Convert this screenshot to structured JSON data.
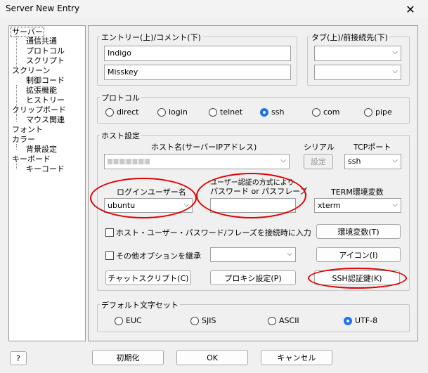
{
  "window": {
    "title": "Server New Entry",
    "close_glyph": "✕"
  },
  "tree": {
    "items": [
      {
        "label": "サーバー",
        "level": 0,
        "selected": true
      },
      {
        "label": "通信共通",
        "level": 1
      },
      {
        "label": "プロトコル",
        "level": 1
      },
      {
        "label": "スクリプト",
        "level": 1
      },
      {
        "label": "スクリーン",
        "level": 0
      },
      {
        "label": "制御コード",
        "level": 1
      },
      {
        "label": "拡張機能",
        "level": 1
      },
      {
        "label": "ヒストリー",
        "level": 1
      },
      {
        "label": "クリップボード",
        "level": 0
      },
      {
        "label": "マウス関連",
        "level": 1
      },
      {
        "label": "フォント",
        "level": 0
      },
      {
        "label": "カラー",
        "level": 0
      },
      {
        "label": "背景設定",
        "level": 1
      },
      {
        "label": "キーボード",
        "level": 0
      },
      {
        "label": "キーコード",
        "level": 1
      }
    ]
  },
  "entry": {
    "legend": "エントリー(上)/コメント(下)",
    "name": "Indigo",
    "comment": "Misskey"
  },
  "tab": {
    "legend": "タブ(上)/前接続先(下)"
  },
  "protocol": {
    "legend": "プロトコル",
    "options": [
      {
        "label": "direct",
        "checked": false
      },
      {
        "label": "login",
        "checked": false
      },
      {
        "label": "telnet",
        "checked": false
      },
      {
        "label": "ssh",
        "checked": true
      },
      {
        "label": "com",
        "checked": false
      },
      {
        "label": "pipe",
        "checked": false
      }
    ]
  },
  "host": {
    "legend": "ホスト設定",
    "hostname_label": "ホスト名(サーバーIPアドレス)",
    "serial_label": "シリアル",
    "serial_button": "設定",
    "tcp_label": "TCPポート",
    "tcp_value": "ssh",
    "login_user_label": "ログインユーザー名",
    "login_user_value": "ubuntu",
    "auth_label_line1": "ユーザー認証の方式により",
    "auth_label_line2": "パスワード or パスフレーズ",
    "term_label": "TERM環境変数",
    "term_value": "xterm",
    "check_input_on_connect": "ホスト・ユーザー・パスワード/フレーズを接続時に入力",
    "env_button": "環境変数(T)",
    "check_other_options": "その他オプションを継承",
    "icon_button": "アイコン(I)",
    "chat_script_button": "チャットスクリプト(C)",
    "proxy_button": "プロキシ設定(P)",
    "ssh_key_button": "SSH認証鍵(K)"
  },
  "charset": {
    "legend": "デフォルト文字セット",
    "options": [
      {
        "label": "EUC",
        "checked": false
      },
      {
        "label": "SJIS",
        "checked": false
      },
      {
        "label": "ASCII",
        "checked": false
      },
      {
        "label": "UTF-8",
        "checked": true
      }
    ]
  },
  "footer": {
    "help": "?",
    "reset": "初期化",
    "ok": "OK",
    "cancel": "キャンセル"
  },
  "colors": {
    "annotation": "#e00000",
    "radio_selected": "#1a73e8"
  }
}
